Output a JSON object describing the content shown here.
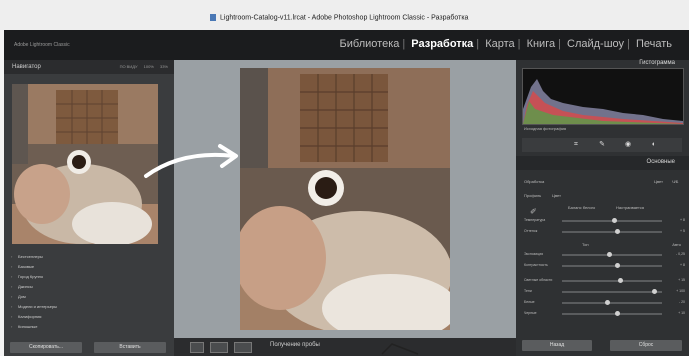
{
  "window": {
    "title": "Lightroom-Catalog-v11.lrcat - Adobe Photoshop Lightroom Classic - Разработка",
    "brand": "Adobe Lightroom Classic"
  },
  "modules": [
    "Библиотека",
    "Разработка",
    "Карта",
    "Книга",
    "Слайд-шоу",
    "Печать"
  ],
  "active_module": "Разработка",
  "left_panel": {
    "navigator_label": "Навигатор",
    "nav_options": [
      "ПО ВИДУ",
      "100%",
      "33%"
    ],
    "presets": [
      "Бестселлеры",
      "Базовые",
      "Город Крупно",
      "Джинсы",
      "Дом",
      "Модели и интерьеры",
      "Калифорния",
      "Киношные"
    ],
    "copy_button": "Скопировать...",
    "paste_button": "Вставить"
  },
  "filmstrip": {
    "soft_proof_label": "Получение пробы"
  },
  "right_panel": {
    "histogram_label": "Гистограмма",
    "original_photo_label": "Исходная фотография",
    "basic_label": "Основные",
    "treatment_label": "Обработка",
    "color_label": "Цвет",
    "bw_label": "Ч/Б",
    "profile_label": "Профиль",
    "profile_value": "Цвет",
    "wb_label": "Баланс белого",
    "wb_value": "Настраивается",
    "temp_label": "Температура",
    "temp_value": "+ 8",
    "tint_label": "Оттенок",
    "tint_value": "+ 5",
    "tone_label": "Тон",
    "tone_auto": "Авто",
    "exposure_label": "Экспозиция",
    "exposure_value": "- 0,25",
    "contrast_label": "Контрастность",
    "contrast_value": "+ 8",
    "highlights_label": "Светлые области",
    "highlights_value": "+ 15",
    "shadows_label": "Тени",
    "shadows_value": "+ 100",
    "whites_label": "Белые",
    "whites_value": "- 20",
    "blacks_label": "Черные",
    "blacks_value": "+ 10",
    "prev_button": "Назад",
    "reset_button": "Сброс"
  },
  "colors": {
    "header_bg": "#1b1c1e",
    "panel_bg": "#3a3c3e",
    "center_bg": "#9aa0a4",
    "accent": "#ffffff"
  },
  "values": {
    "temp": 0.52,
    "tint": 0.55,
    "exposure": 0.47,
    "contrast": 0.55,
    "highlights": 0.58,
    "shadows": 0.92,
    "whites": 0.45,
    "blacks": 0.55
  }
}
